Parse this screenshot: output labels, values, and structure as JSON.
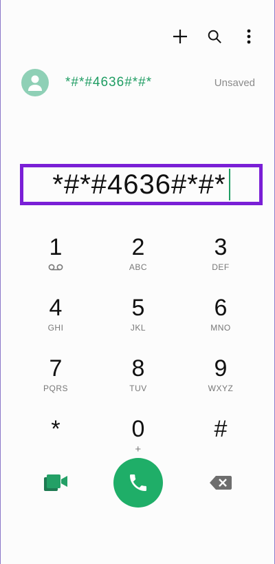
{
  "header": {
    "actions": [
      {
        "name": "plus-icon"
      },
      {
        "name": "search-icon"
      },
      {
        "name": "more-vertical-icon"
      }
    ]
  },
  "contact_suggestion": {
    "number": "*#*#4636#*#*",
    "status": "Unsaved",
    "avatar_color": "#8fd0b6",
    "number_color": "#1e9c62"
  },
  "dialer": {
    "input_value": "*#*#4636#*#*",
    "highlight_color": "#7a1fd6"
  },
  "keypad": {
    "rows": [
      [
        {
          "digit": "1",
          "letters": ""
        },
        {
          "digit": "2",
          "letters": "ABC"
        },
        {
          "digit": "3",
          "letters": "DEF"
        }
      ],
      [
        {
          "digit": "4",
          "letters": "GHI"
        },
        {
          "digit": "5",
          "letters": "JKL"
        },
        {
          "digit": "6",
          "letters": "MNO"
        }
      ],
      [
        {
          "digit": "7",
          "letters": "PQRS"
        },
        {
          "digit": "8",
          "letters": "TUV"
        },
        {
          "digit": "9",
          "letters": "WXYZ"
        }
      ],
      [
        {
          "digit": "*",
          "letters": ""
        },
        {
          "digit": "0",
          "letters": "+"
        },
        {
          "digit": "#",
          "letters": ""
        }
      ]
    ]
  },
  "bottom": {
    "call_color": "#1fae68"
  }
}
